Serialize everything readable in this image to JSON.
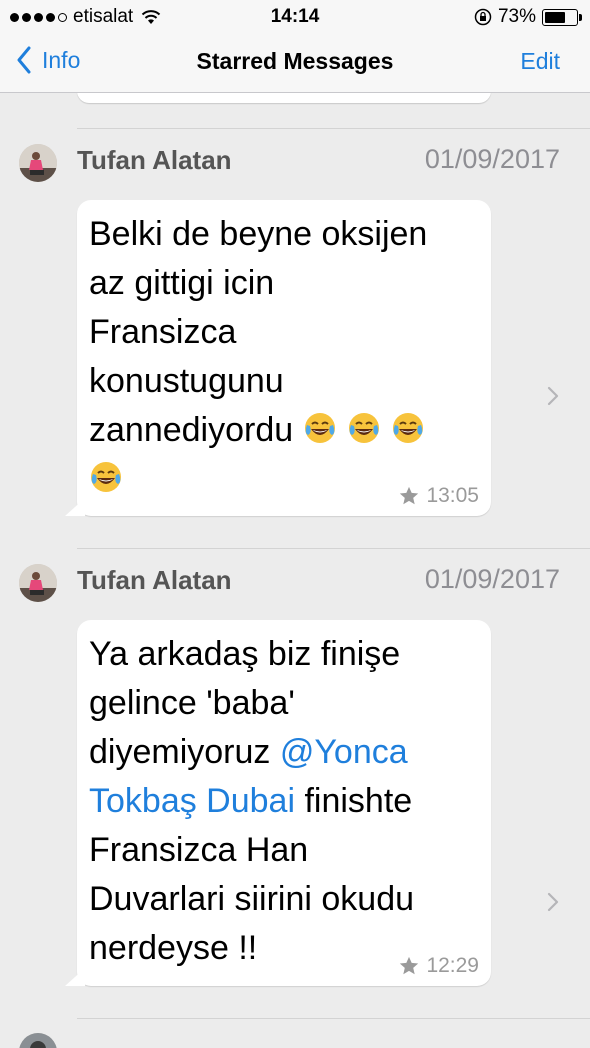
{
  "status_bar": {
    "carrier": "etisalat",
    "time": "14:14",
    "battery_percent": "73%",
    "battery_level": 0.73
  },
  "nav": {
    "back_label": "Info",
    "title": "Starred Messages",
    "edit_label": "Edit"
  },
  "messages": [
    {
      "sender": "Tufan Alatan",
      "date": "01/09/2017",
      "text_lines": [
        "Belki de beyne oksijen",
        "az gittigi icin",
        "Fransizca",
        "konustugunu",
        "zannediyordu"
      ],
      "emoji_count": 4,
      "time": "13:05",
      "starred": true
    },
    {
      "sender": "Tufan Alatan",
      "date": "01/09/2017",
      "text_line1": "Ya arkadaş biz finişe",
      "text_line2": "gelince 'baba'",
      "text_line3_pre": "diyemiyoruz ",
      "mention": "@Yonca",
      "mention_cont": "Tokbaş Dubai",
      "text_line4_post": " finishte",
      "text_line5": "Fransizca Han",
      "text_line6": "Duvarlari siirini okudu",
      "text_line7": "nerdeyse !!",
      "time": "12:29",
      "starred": true
    }
  ],
  "colors": {
    "accent": "#1f7fdc",
    "background": "#ececec",
    "bubble": "#ffffff"
  }
}
